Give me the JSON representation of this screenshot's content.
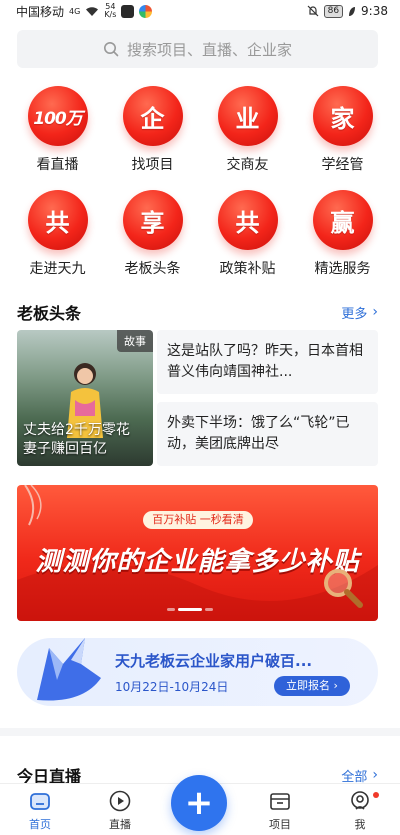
{
  "status_bar": {
    "carrier": "中国移动",
    "network": "4G",
    "speed_value": "54",
    "speed_unit": "K/s",
    "battery": "86",
    "time": "9:38"
  },
  "search": {
    "placeholder": "搜索项目、直播、企业家"
  },
  "grid": [
    {
      "badge": "100万",
      "label": "看直播"
    },
    {
      "badge": "企",
      "label": "找项目"
    },
    {
      "badge": "业",
      "label": "交商友"
    },
    {
      "badge": "家",
      "label": "学经管"
    },
    {
      "badge": "共",
      "label": "走进天九"
    },
    {
      "badge": "享",
      "label": "老板头条"
    },
    {
      "badge": "共",
      "label": "政策补贴"
    },
    {
      "badge": "赢",
      "label": "精选服务"
    }
  ],
  "headlines": {
    "title": "老板头条",
    "more": "更多",
    "featured": {
      "tag": "故事",
      "caption": "丈夫给2千万零花 妻子赚回百亿"
    },
    "items": [
      "这是站队了吗？昨天，日本首相普义伟向靖国神社...",
      "外卖下半场：饿了么“飞轮”已动，美团底牌出尽"
    ]
  },
  "banner": {
    "pill": "百万补贴 一秒看清",
    "headline": "测测你的企业能拿多少补贴"
  },
  "promo": {
    "title": "天九老板云企业家用户破百...",
    "date": "10月22日-10月24日",
    "button": "立即报名"
  },
  "live": {
    "title": "今日直播",
    "more": "全部"
  },
  "tabbar": [
    {
      "label": "首页",
      "active": true
    },
    {
      "label": "直播",
      "active": false
    },
    {
      "label": "项目",
      "active": false
    },
    {
      "label": "我",
      "active": false
    }
  ],
  "colors": {
    "accent": "#2e6fd8",
    "brand_red": "#f3251a",
    "fab": "#2f74ee"
  }
}
